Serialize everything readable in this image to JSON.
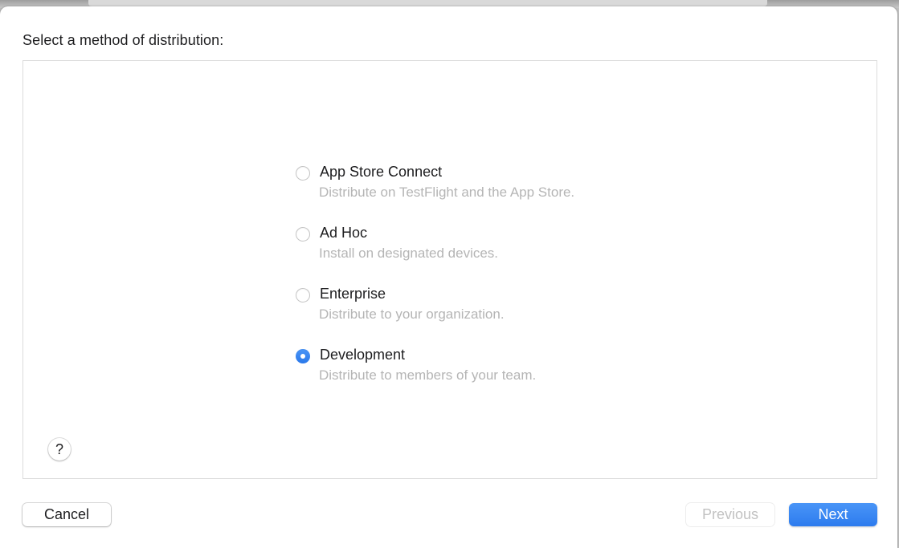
{
  "dialog": {
    "heading": "Select a method of distribution:",
    "accent_color": "#3a86f2"
  },
  "options": [
    {
      "title": "App Store Connect",
      "description": "Distribute on TestFlight and the App Store.",
      "selected": false
    },
    {
      "title": "Ad Hoc",
      "description": "Install on designated devices.",
      "selected": false
    },
    {
      "title": "Enterprise",
      "description": "Distribute to your organization.",
      "selected": false
    },
    {
      "title": "Development",
      "description": "Distribute to members of your team.",
      "selected": true
    }
  ],
  "help": {
    "label": "?"
  },
  "buttons": {
    "cancel": "Cancel",
    "previous": "Previous",
    "next": "Next",
    "previous_enabled": false
  }
}
